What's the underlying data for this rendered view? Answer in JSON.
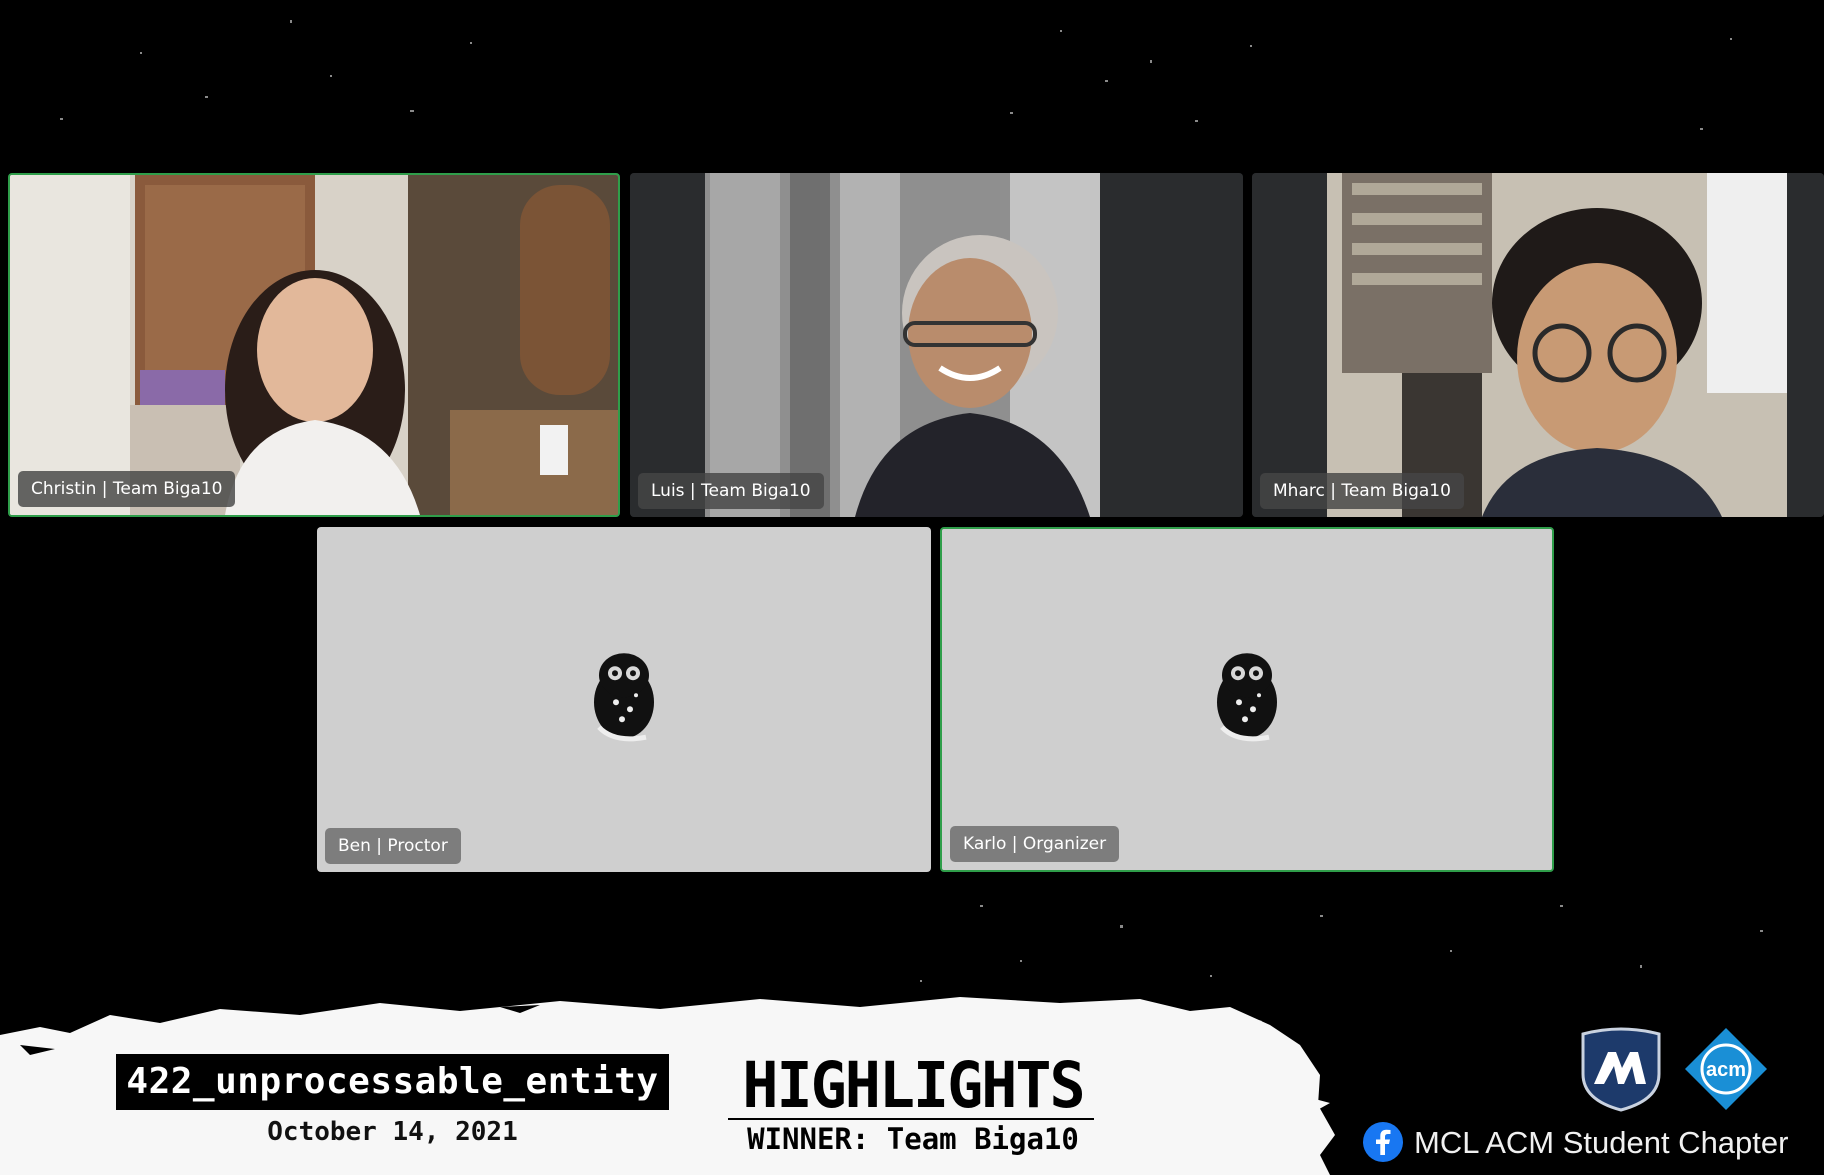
{
  "participants": [
    {
      "name": "Christin | Team Biga10"
    },
    {
      "name": "Luis | Team Biga10"
    },
    {
      "name": "Mharc | Team Biga10"
    },
    {
      "name": "Ben | Proctor"
    },
    {
      "name": "Karlo | Organizer"
    }
  ],
  "banner": {
    "event_name": "422_unprocessable_entity",
    "date": "October 14, 2021",
    "headline": "HIGHLIGHTS",
    "winner": "WINNER: Team Biga10",
    "org_name": "MCL ACM Student Chapter",
    "acm_logo_text": "acm"
  },
  "colors": {
    "active_speaker_border": "#2f9e4a",
    "background": "#000000",
    "blank_tile": "#cfcfcf",
    "facebook_blue": "#1877f2",
    "acm_blue": "#1a8fd6",
    "mcl_navy": "#1d3a6b"
  },
  "icons": [
    "owl-avatar-icon",
    "facebook-icon",
    "mcl-shield-logo",
    "acm-logo"
  ]
}
